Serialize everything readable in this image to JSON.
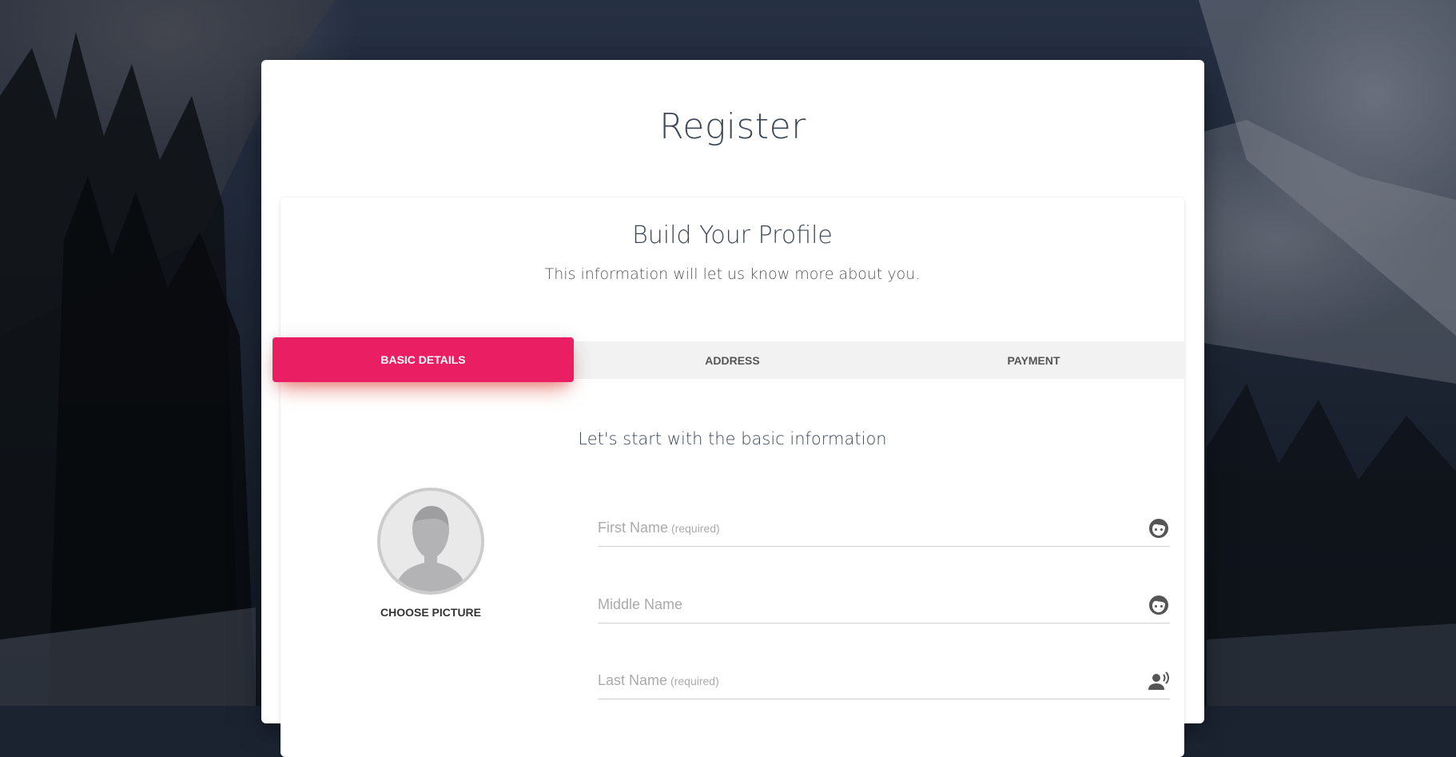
{
  "page": {
    "title": "Register"
  },
  "wizard": {
    "title": "Build Your Profile",
    "subtitle": "This information will let us know more about you.",
    "tabs": [
      {
        "label": "BASIC DETAILS",
        "active": true
      },
      {
        "label": "ADDRESS",
        "active": false
      },
      {
        "label": "PAYMENT",
        "active": false
      }
    ],
    "accent_color": "#e91e63"
  },
  "step": {
    "heading": "Let's start with the basic information",
    "picture": {
      "label": "CHOOSE PICTURE",
      "icon": "avatar-placeholder"
    },
    "fields": [
      {
        "label": "First Name",
        "hint": "(required)",
        "value": "",
        "icon": "face-icon"
      },
      {
        "label": "Middle Name",
        "hint": "",
        "value": "",
        "icon": "face-icon"
      },
      {
        "label": "Last Name",
        "hint": "(required)",
        "value": "",
        "icon": "record-voice-icon"
      }
    ]
  }
}
